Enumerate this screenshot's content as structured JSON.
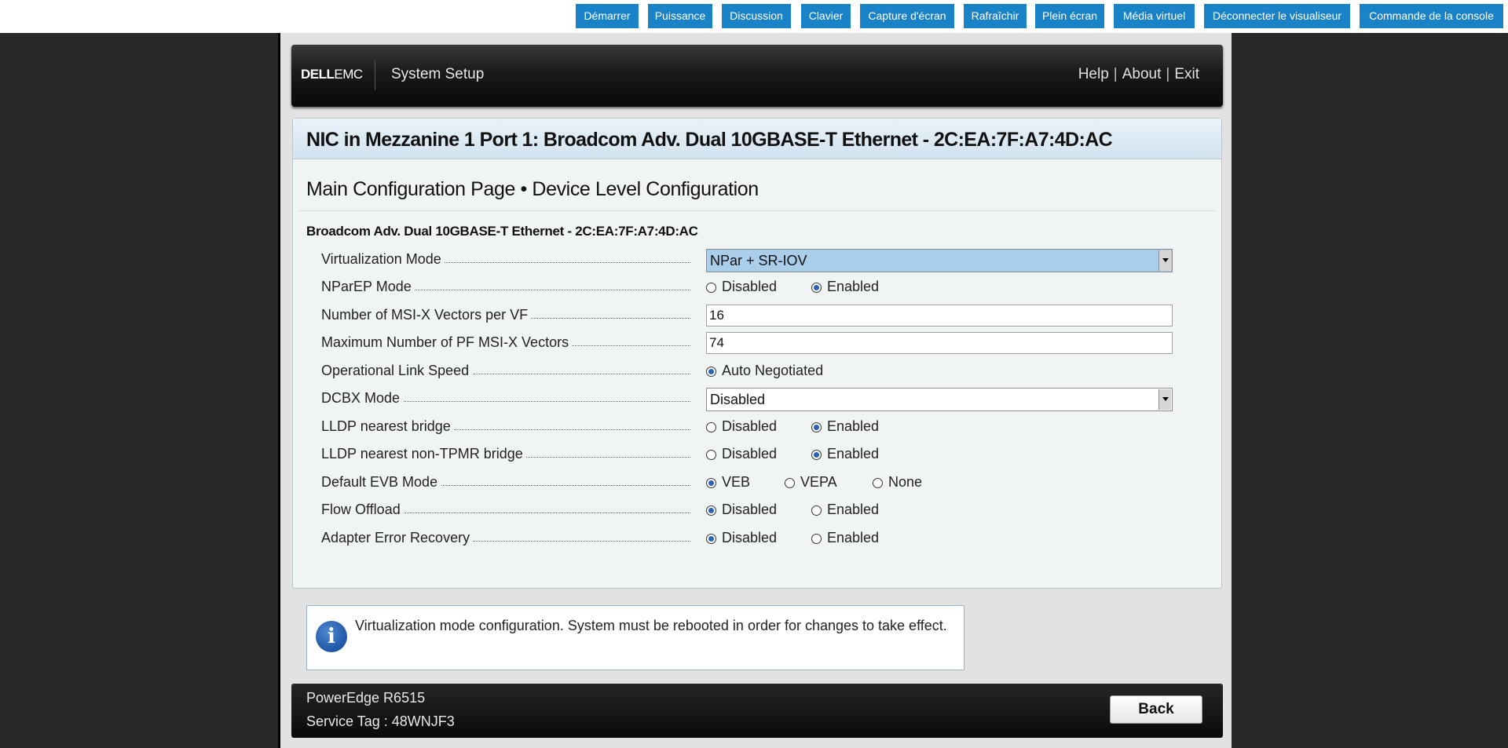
{
  "toolbar": {
    "buttons": [
      "Démarrer",
      "Puissance",
      "Discussion",
      "Clavier",
      "Capture d'écran",
      "Rafraîchir",
      "Plein écran",
      "Média virtuel",
      "Déconnecter le visualiseur",
      "Commande de la console"
    ],
    "accent": "#1a82c6"
  },
  "header": {
    "logo_dell": "DELL",
    "logo_emc": "EMC",
    "title": "System Setup",
    "links": [
      "Help",
      "About",
      "Exit"
    ],
    "separator": "|"
  },
  "page": {
    "title": "NIC in Mezzanine 1 Port 1: Broadcom Adv. Dual 10GBASE-T Ethernet - 2C:EA:7F:A7:4D:AC",
    "subtitle": "Main Configuration Page • Device Level Configuration",
    "device": "Broadcom Adv. Dual 10GBASE-T Ethernet - 2C:EA:7F:A7:4D:AC"
  },
  "settings": [
    {
      "label": "Virtualization Mode",
      "type": "select",
      "value": "NPar + SR-IOV",
      "highlighted": true
    },
    {
      "label": "NParEP Mode",
      "type": "radio",
      "options": [
        "Disabled",
        "Enabled"
      ],
      "selected": 1
    },
    {
      "label": "Number of MSI-X Vectors per VF",
      "type": "text",
      "value": "16"
    },
    {
      "label": "Maximum Number of PF MSI-X Vectors",
      "type": "text",
      "value": "74"
    },
    {
      "label": "Operational Link Speed",
      "type": "radio",
      "options": [
        "Auto Negotiated"
      ],
      "selected": 0
    },
    {
      "label": "DCBX Mode",
      "type": "select",
      "value": "Disabled",
      "highlighted": false
    },
    {
      "label": "LLDP nearest bridge",
      "type": "radio",
      "options": [
        "Disabled",
        "Enabled"
      ],
      "selected": 1
    },
    {
      "label": "LLDP nearest non-TPMR bridge",
      "type": "radio",
      "options": [
        "Disabled",
        "Enabled"
      ],
      "selected": 1
    },
    {
      "label": "Default EVB Mode",
      "type": "radio",
      "options": [
        "VEB",
        "VEPA",
        "None"
      ],
      "selected": 0
    },
    {
      "label": "Flow Offload",
      "type": "radio",
      "options": [
        "Disabled",
        "Enabled"
      ],
      "selected": 0
    },
    {
      "label": "Adapter Error Recovery",
      "type": "radio",
      "options": [
        "Disabled",
        "Enabled"
      ],
      "selected": 0
    }
  ],
  "info": {
    "icon": "info-icon",
    "text": "Virtualization mode configuration. System must be rebooted in order for changes to take effect."
  },
  "footer": {
    "model": "PowerEdge R6515",
    "service_tag": "Service Tag : 48WNJF3",
    "back_label": "Back"
  }
}
